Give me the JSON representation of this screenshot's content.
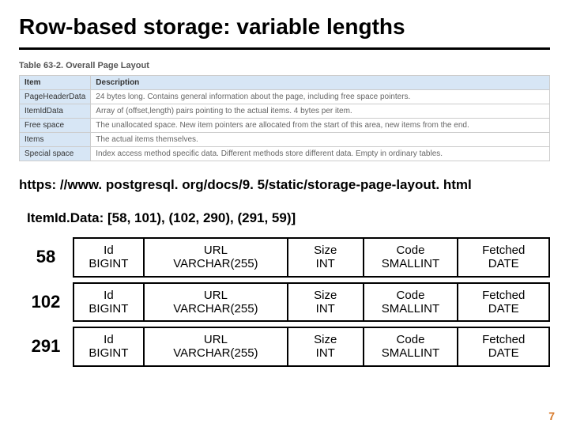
{
  "title": "Row-based storage: variable lengths",
  "table_caption": "Table 63-2. Overall Page Layout",
  "layout_headers": {
    "item": "Item",
    "desc": "Description"
  },
  "layout_rows": [
    {
      "item": "PageHeaderData",
      "desc": "24 bytes long. Contains general information about the page, including free space pointers."
    },
    {
      "item": "ItemIdData",
      "desc": "Array of (offset,length) pairs pointing to the actual items. 4 bytes per item."
    },
    {
      "item": "Free space",
      "desc": "The unallocated space. New item pointers are allocated from the start of this area, new items from the end."
    },
    {
      "item": "Items",
      "desc": "The actual items themselves."
    },
    {
      "item": "Special space",
      "desc": "Index access method specific data. Different methods store different data. Empty in ordinary tables."
    }
  ],
  "source_url": "https: //www. postgresql. org/docs/9. 5/static/storage-page-layout. html",
  "itemid_line": "ItemId.Data:  [58, 101), (102, 290), (291, 59)]",
  "columns": [
    {
      "name": "Id",
      "type": "BIGINT",
      "cls": "c-id"
    },
    {
      "name": "URL",
      "type": "VARCHAR(255)",
      "cls": "c-url"
    },
    {
      "name": "Size",
      "type": "INT",
      "cls": "c-size"
    },
    {
      "name": "Code",
      "type": "SMALLINT",
      "cls": "c-code"
    },
    {
      "name": "Fetched",
      "type": "DATE",
      "cls": "c-fetched"
    }
  ],
  "offsets": [
    "58",
    "102",
    "291"
  ],
  "page_number": "7"
}
